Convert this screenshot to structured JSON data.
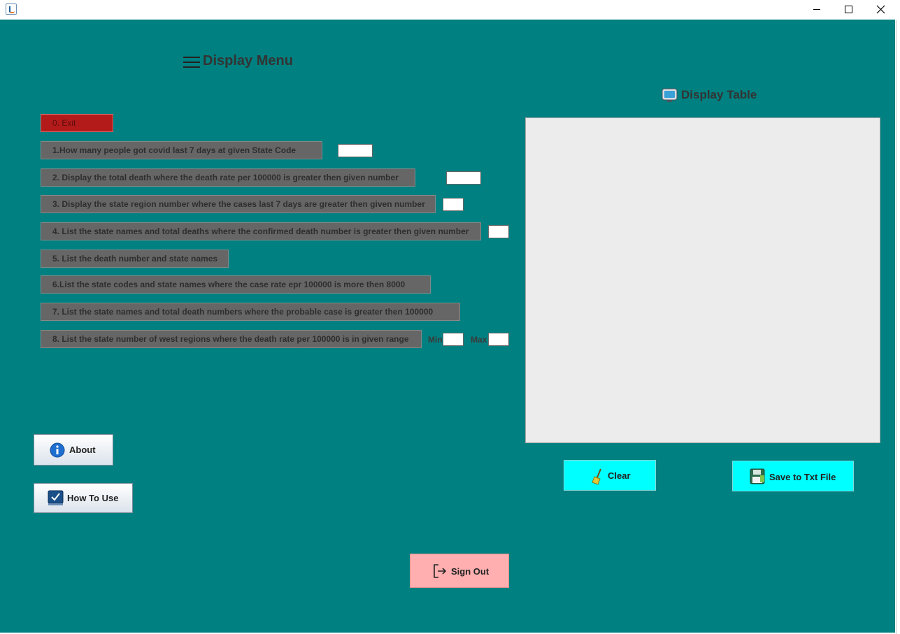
{
  "window": {
    "title": ""
  },
  "menu": {
    "title": "Display Menu"
  },
  "options": [
    {
      "label": "0. Exit"
    },
    {
      "label": "1.How many people got covid last 7 days at given State Code"
    },
    {
      "label": "2. Display the total death where the death rate per 100000 is greater then given number"
    },
    {
      "label": "3. Display the state region number where the cases last 7 days are greater then given number"
    },
    {
      "label": "4. List the state names and total deaths where the confirmed death number is greater then given number"
    },
    {
      "label": "5. List the death number and state names"
    },
    {
      "label": "6.List the state codes and state names where the case rate epr 100000 is more then 8000"
    },
    {
      "label": "7. List the state names and total death numbers where the probable case is greater then 100000"
    },
    {
      "label": "8. List the state number of west regions where the death rate per 100000 is in given range"
    }
  ],
  "inputs": {
    "state_code": "",
    "death_rate": "",
    "cases_last7": "",
    "confirmed_death": "",
    "range_min_label": "Min",
    "range_max_label": "Max",
    "range_min": "",
    "range_max": ""
  },
  "buttons": {
    "about": "About",
    "how_to_use": "How To Use",
    "sign_out": "Sign Out",
    "clear": "Clear",
    "save": "Save to Txt File"
  },
  "table": {
    "title": "Display Table",
    "content": ""
  },
  "colors": {
    "background": "#008080",
    "option_button": "#666666",
    "exit_button": "#b31b1b",
    "action_button": "#00ffff",
    "sign_out_button": "#ffafaf"
  },
  "icons": {
    "menu": "hamburger-menu-icon",
    "table": "monitor-icon",
    "about": "info-icon",
    "how_to_use": "checkmark-screen-icon",
    "sign_out": "sign-out-icon",
    "clear": "broom-icon",
    "save": "floppy-disk-icon"
  }
}
